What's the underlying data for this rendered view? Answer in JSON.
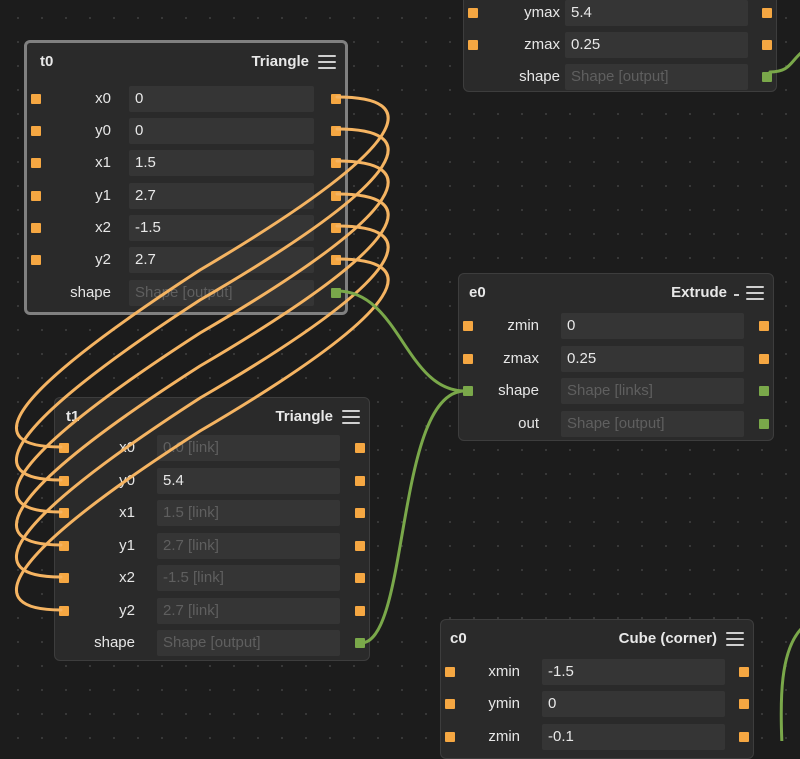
{
  "colors": {
    "background": "#1c1c1c",
    "float_wire": "#f5b462",
    "shape_wire": "#7aa84a",
    "float_port": "#f5a742",
    "shape_port": "#7aa84a"
  },
  "nodes": {
    "partial": {
      "rows": [
        {
          "label": "ymax",
          "value": "5.4",
          "placeholder": false
        },
        {
          "label": "zmax",
          "value": "0.25",
          "placeholder": false
        },
        {
          "label": "shape",
          "value": "Shape [output]",
          "placeholder": true
        }
      ]
    },
    "t0": {
      "id": "t0",
      "type": "Triangle",
      "rows": [
        {
          "label": "x0",
          "value": "0",
          "placeholder": false
        },
        {
          "label": "y0",
          "value": "0",
          "placeholder": false
        },
        {
          "label": "x1",
          "value": "1.5",
          "placeholder": false
        },
        {
          "label": "y1",
          "value": "2.7",
          "placeholder": false
        },
        {
          "label": "x2",
          "value": "-1.5",
          "placeholder": false
        },
        {
          "label": "y2",
          "value": "2.7",
          "placeholder": false
        },
        {
          "label": "shape",
          "value": "Shape [output]",
          "placeholder": true
        }
      ]
    },
    "e0": {
      "id": "e0",
      "type": "Extrude",
      "rows": [
        {
          "label": "zmin",
          "value": "0",
          "placeholder": false
        },
        {
          "label": "zmax",
          "value": "0.25",
          "placeholder": false
        },
        {
          "label": "shape",
          "value": "Shape [links]",
          "placeholder": true
        },
        {
          "label": "out",
          "value": "Shape [output]",
          "placeholder": true
        }
      ]
    },
    "t1": {
      "id": "t1",
      "type": "Triangle",
      "rows": [
        {
          "label": "x0",
          "value": "0.0 [link]",
          "placeholder": true
        },
        {
          "label": "y0",
          "value": "5.4",
          "placeholder": false
        },
        {
          "label": "x1",
          "value": "1.5 [link]",
          "placeholder": true
        },
        {
          "label": "y1",
          "value": "2.7 [link]",
          "placeholder": true
        },
        {
          "label": "x2",
          "value": "-1.5 [link]",
          "placeholder": true
        },
        {
          "label": "y2",
          "value": "2.7 [link]",
          "placeholder": true
        },
        {
          "label": "shape",
          "value": "Shape [output]",
          "placeholder": true
        }
      ]
    },
    "c0": {
      "id": "c0",
      "type": "Cube (corner)",
      "rows": [
        {
          "label": "xmin",
          "value": "-1.5",
          "placeholder": false
        },
        {
          "label": "ymin",
          "value": "0",
          "placeholder": false
        },
        {
          "label": "zmin",
          "value": "-0.1",
          "placeholder": false
        }
      ]
    }
  }
}
